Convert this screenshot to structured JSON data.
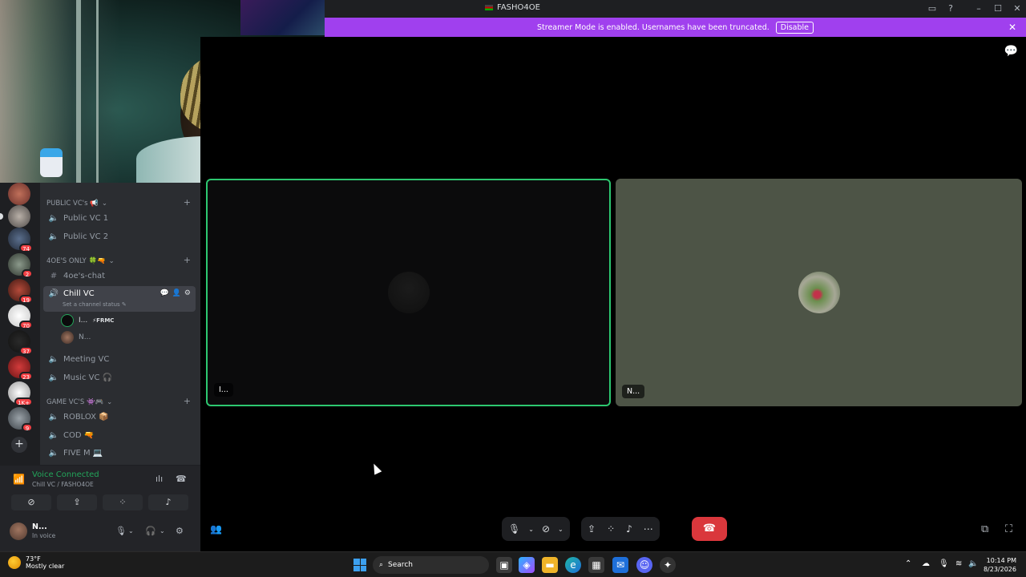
{
  "window": {
    "title": "FASHO4OE"
  },
  "banner": {
    "message": "Streamer Mode is enabled. Usernames have been truncated.",
    "disable_label": "Disable"
  },
  "servers": [
    {
      "badge": ""
    },
    {
      "badge": "74"
    },
    {
      "badge": "2"
    },
    {
      "badge": "19"
    },
    {
      "badge": "70"
    },
    {
      "badge": "37"
    },
    {
      "badge": "23"
    },
    {
      "badge": "1K+"
    },
    {
      "badge": "9"
    }
  ],
  "categories": [
    {
      "name": "PUBLIC VC's 📢",
      "channels": [
        "Public VC 1",
        "Public VC 2"
      ]
    },
    {
      "name": "4OE'S ONLY 🍀🔫",
      "channels": [
        "4oe's-chat",
        "Chill VC",
        "Meeting VC",
        "Music VC 🎧"
      ]
    },
    {
      "name": "GAME VC'S 👾🎮",
      "channels": [
        "ROBLOX 📦",
        "COD 🔫",
        "FIVE M 💻"
      ]
    }
  ],
  "active_channel": {
    "name": "Chill VC",
    "status_placeholder": "Set a channel status ✎"
  },
  "members": [
    {
      "name": "I...",
      "tag": "⚡FRMC"
    },
    {
      "name": "N..."
    }
  ],
  "voice": {
    "title": "Voice Connected",
    "location": "Chill VC / FASHO4OE"
  },
  "user": {
    "name": "N...",
    "status": "In voice"
  },
  "tiles": [
    {
      "label": "I..."
    },
    {
      "label": "N..."
    }
  ],
  "taskbar": {
    "temperature": "73°F",
    "condition": "Mostly clear",
    "search_placeholder": "Search",
    "time": "10:14 PM",
    "date": "8/23/2026"
  },
  "colors": {
    "accent": "#a040ee",
    "speaking": "#2dc770",
    "hangup": "#da373c",
    "voice_ok": "#23a55a"
  }
}
